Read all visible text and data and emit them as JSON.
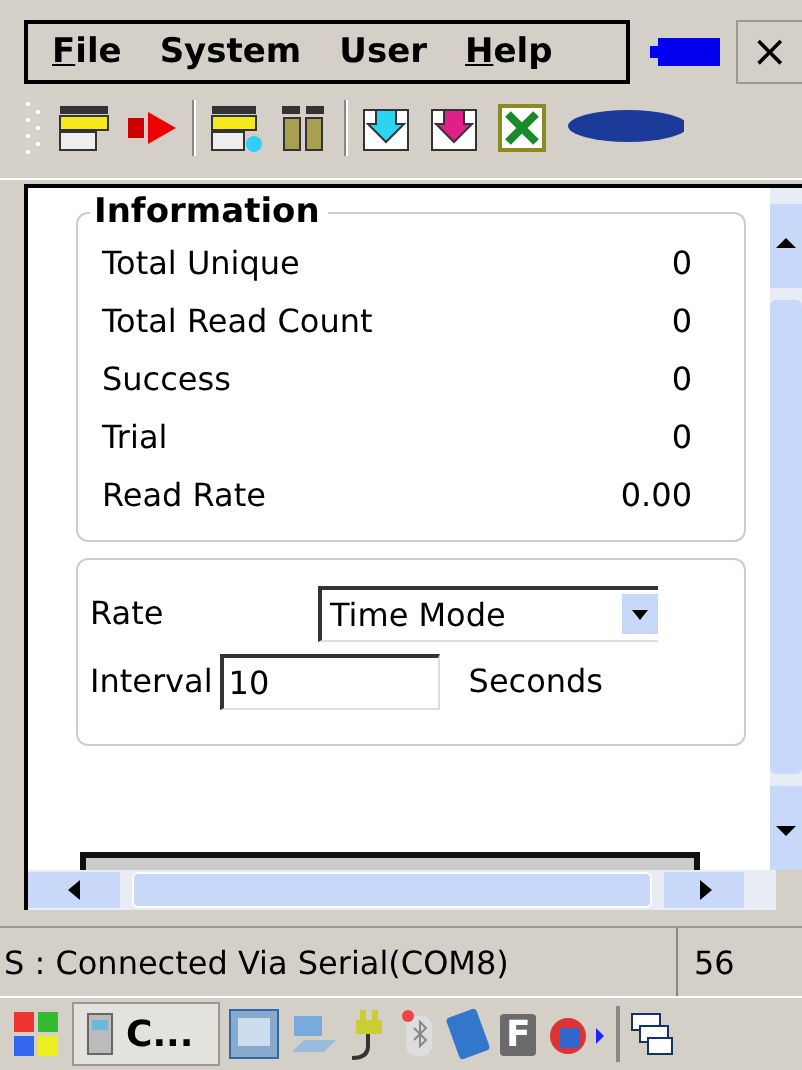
{
  "menu": [
    {
      "label": "File",
      "mnemonic_underlined": true
    },
    {
      "label": "System",
      "mnemonic_underlined": false
    },
    {
      "label": "User",
      "mnemonic_underlined": false
    },
    {
      "label": "Help",
      "mnemonic_underlined": true
    }
  ],
  "close_label": "×",
  "information": {
    "title": "Information",
    "rows": [
      {
        "label": "Total Unique",
        "value": "0"
      },
      {
        "label": "Total Read Count",
        "value": "0"
      },
      {
        "label": "Success",
        "value": "0"
      },
      {
        "label": "Trial",
        "value": "0"
      },
      {
        "label": "Read Rate",
        "value": "0.00"
      }
    ]
  },
  "settings": {
    "rate_label": "Rate",
    "rate_value": "Time Mode",
    "interval_label": "Interval",
    "interval_value": "10",
    "interval_unit": "Seconds"
  },
  "status_bar": {
    "text": "S : Connected Via Serial(COM8)",
    "field_2": "56"
  },
  "taskbar": {
    "task_label": "C...",
    "tray_text": "F"
  }
}
